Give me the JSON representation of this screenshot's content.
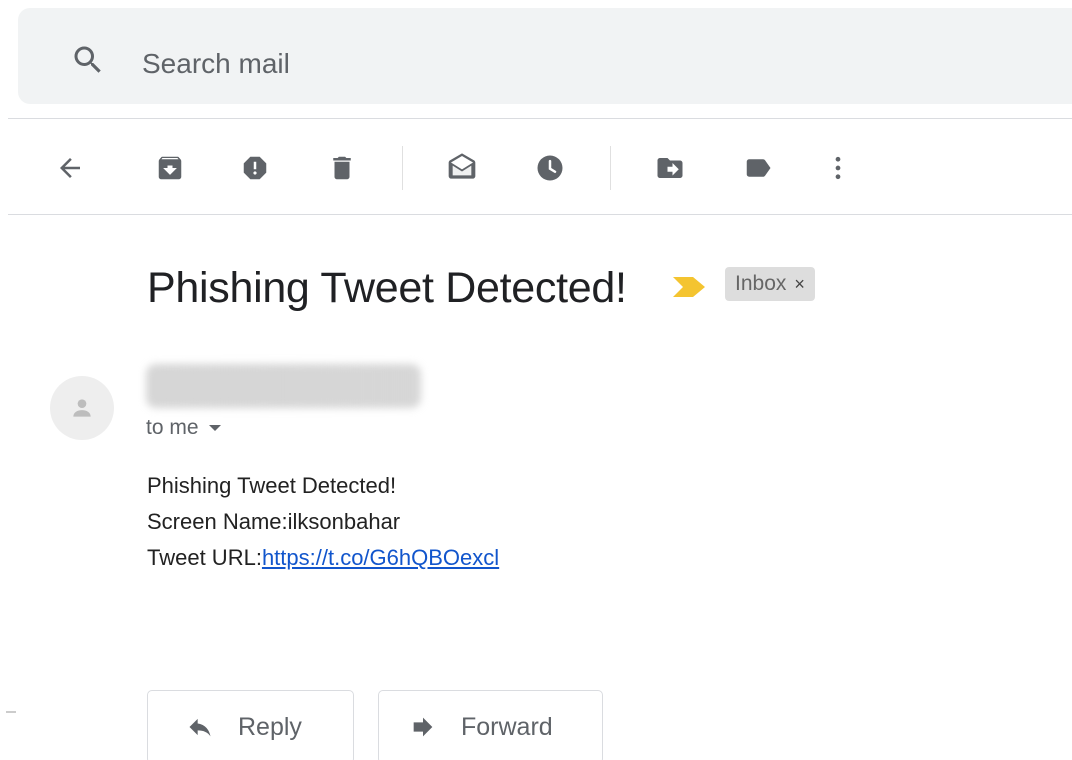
{
  "search": {
    "placeholder": "Search mail"
  },
  "toolbar": {
    "icons": [
      "back-arrow-icon",
      "archive-icon",
      "report-spam-icon",
      "delete-icon",
      "mark-unread-icon",
      "snooze-icon",
      "move-to-icon",
      "label-icon",
      "more-vert-icon"
    ]
  },
  "email": {
    "subject": "Phishing Tweet Detected!",
    "label": "Inbox",
    "label_close": "×",
    "sender": "████████████",
    "recipient": "to me",
    "body": {
      "line1": "Phishing Tweet Detected!",
      "line2": "Screen Name:ilksonbahar",
      "line3_prefix": "Tweet URL:",
      "line3_link": "https://t.co/G6hQBOexcl"
    }
  },
  "actions": {
    "reply_label": "Reply",
    "forward_label": "Forward"
  },
  "colors": {
    "importance_marker": "#f4c430",
    "link": "#1155cc",
    "icon": "#5f6368"
  }
}
